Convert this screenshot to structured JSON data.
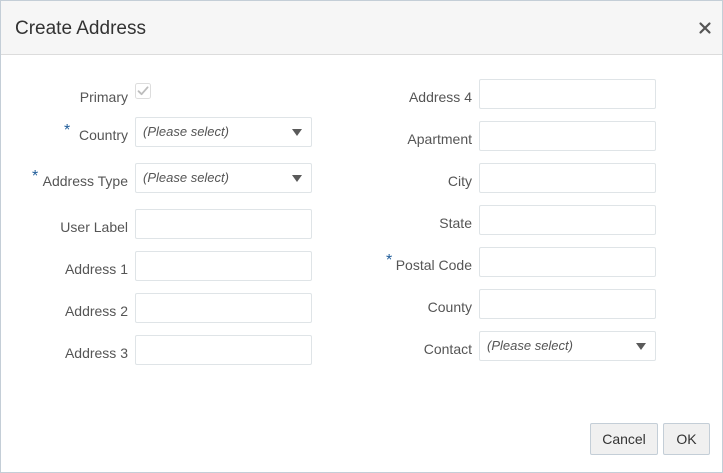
{
  "dialog": {
    "title": "Create Address",
    "close_glyph": "×"
  },
  "left": {
    "primary_label": "Primary",
    "primary_checked": true,
    "country_label": "Country",
    "country_value": "(Please select)",
    "address_type_label": "Address Type",
    "address_type_value": "(Please select)",
    "user_label_label": "User Label",
    "address1_label": "Address 1",
    "address2_label": "Address 2",
    "address3_label": "Address 3"
  },
  "right": {
    "address4_label": "Address 4",
    "apartment_label": "Apartment",
    "city_label": "City",
    "state_label": "State",
    "postal_code_label": "Postal Code",
    "county_label": "County",
    "contact_label": "Contact",
    "contact_value": "(Please select)"
  },
  "required_marker": "*",
  "buttons": {
    "cancel": "Cancel",
    "ok": "OK"
  },
  "colors": {
    "required": "#1f5c99",
    "checkbox_check": "#bdbdbd"
  }
}
